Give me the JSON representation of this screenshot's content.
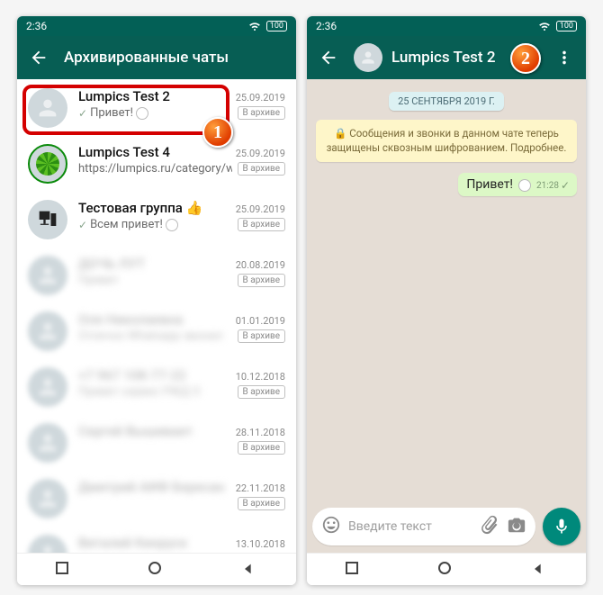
{
  "status": {
    "time": "2:36",
    "battery": "100"
  },
  "left": {
    "title": "Архивированные чаты",
    "archive_label": "В архиве",
    "chats": [
      {
        "name": "Lumpics Test 2",
        "preview": "Привет!",
        "date": "25.09.2019",
        "tick": true,
        "avatar": "person"
      },
      {
        "name": "Lumpics Test 4",
        "preview": "https://lumpics.ru/category/w…",
        "date": "25.09.2019",
        "avatar": "lime"
      },
      {
        "name": "Тестовая группа 👍",
        "preview": "Всем привет!",
        "date": "25.09.2019",
        "tick": true,
        "avatar": "pc"
      },
      {
        "name": "ДОЧЬ ЛУТ",
        "preview": "Привет",
        "date": "20.08.2019",
        "blur": true
      },
      {
        "name": "Оля Николаевна",
        "preview": "Отлично Whatsapp звонил",
        "date": "01.01.2019",
        "blur": true
      },
      {
        "name": "+7 967 108-77-22",
        "preview": "Привет сервис РЖД О",
        "date": "10.12.2018",
        "blur": true
      },
      {
        "name": "Сергей Вышивает",
        "preview": " ",
        "date": "28.11.2018",
        "blur": true
      },
      {
        "name": "Дмитрий АИФ Бересан",
        "preview": " ",
        "date": "22.11.2018",
        "blur": true
      },
      {
        "name": "Виталий Кинруск",
        "preview": " ",
        "date": "13.10.2018",
        "blur": true
      }
    ]
  },
  "right": {
    "title": "Lumpics Test 2",
    "date_pill": "25 СЕНТЯБРЯ 2019 Г.",
    "encryption": "🔒 Сообщения и звонки в данном чате теперь защищены сквозным шифрованием. Подробнее.",
    "message": {
      "text": "Привет!",
      "time": "21:28"
    },
    "input_placeholder": "Введите текст"
  },
  "badges": {
    "one": "1",
    "two": "2"
  }
}
